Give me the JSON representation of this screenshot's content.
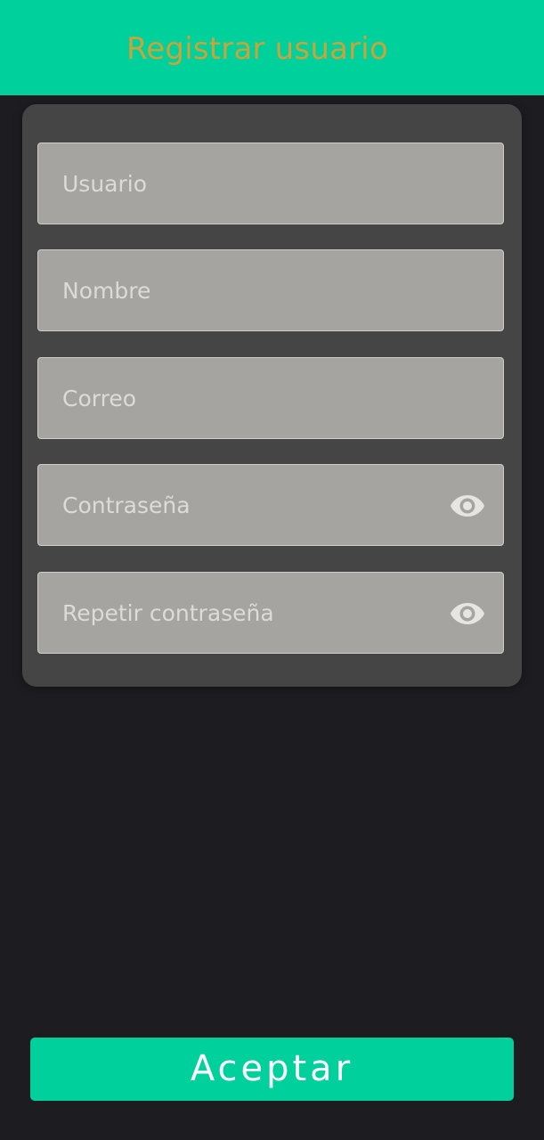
{
  "header": {
    "title": "Registrar usuario",
    "background": "#00d09c",
    "title_color": "#c8a43a"
  },
  "form": {
    "fields": [
      {
        "placeholder": "Usuario",
        "value": ""
      },
      {
        "placeholder": "Nombre",
        "value": ""
      },
      {
        "placeholder": "Correo",
        "value": ""
      },
      {
        "placeholder": "Contraseña",
        "value": "",
        "icon": "eye-icon"
      },
      {
        "placeholder": "Repetir contraseña",
        "value": "",
        "icon": "eye-icon"
      }
    ]
  },
  "actions": {
    "accept_label": "Aceptar",
    "accent": "#00d09c"
  },
  "colors": {
    "page_background": "#1d1c20",
    "card_background": "#454545",
    "field_background": "#a6a4a0"
  }
}
